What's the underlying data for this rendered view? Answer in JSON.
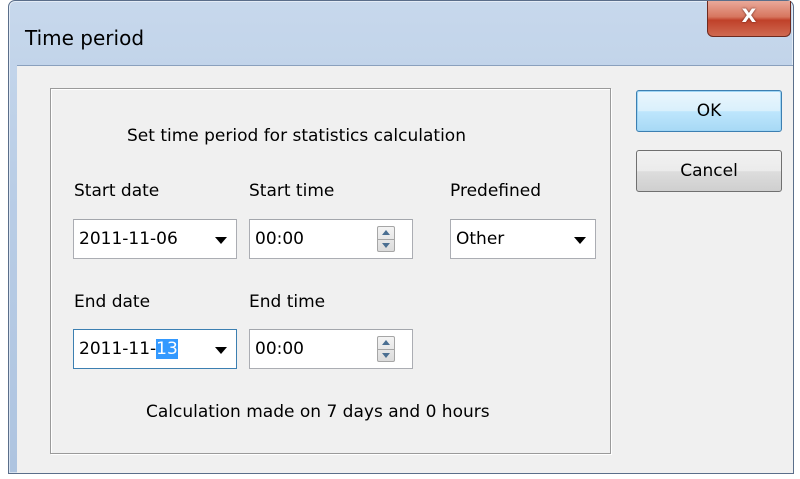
{
  "window": {
    "title": "Time period",
    "close_glyph": "X"
  },
  "group": {
    "heading": "Set time period for statistics calculation",
    "start_date": {
      "label": "Start date",
      "value": "2011-11-06"
    },
    "start_time": {
      "label": "Start time",
      "value": "00:00"
    },
    "predefined": {
      "label": "Predefined",
      "value": "Other"
    },
    "end_date": {
      "label": "End date",
      "value_prefix": "2011-11-",
      "value_selected": "13"
    },
    "end_time": {
      "label": "End time",
      "value": "00:00"
    },
    "summary": "Calculation made on 7 days and 0 hours"
  },
  "buttons": {
    "ok": "OK",
    "cancel": "Cancel"
  },
  "icons": {
    "close": "close-icon",
    "dropdown": "chevron-down-icon",
    "spinner": "spin-updown-icon"
  },
  "colors": {
    "selection": "#3399ff",
    "close_button": "#c0412a",
    "focus_border": "#3c7fb1"
  }
}
